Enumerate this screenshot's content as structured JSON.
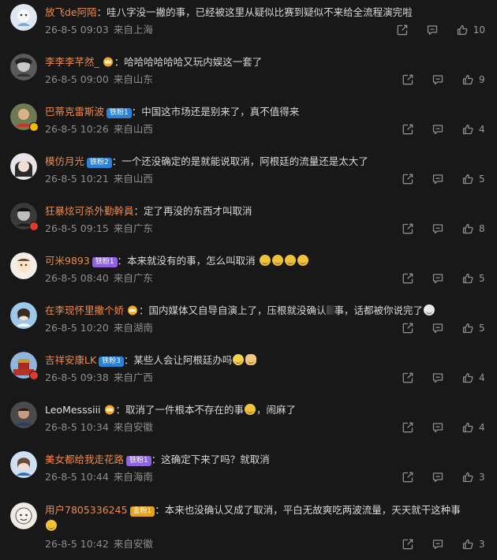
{
  "colors": {
    "background": "#181818",
    "username": "#ef8a45",
    "meta": "#8d8d8d",
    "text": "#d8d8d8"
  },
  "icons": {
    "share": "share-icon",
    "reply": "reply-icon",
    "like": "thumbs-up-icon"
  },
  "comments": [
    {
      "user": "放飞de阿陌",
      "badge": "",
      "text": "哇八字没一撇的事，已经被这里从疑似比赛到疑似不来给全流程演完啦",
      "time": "26-8-5 09:03",
      "loc": "来自上海",
      "likes": "10"
    },
    {
      "user": "李李李芊然_",
      "badge": "",
      "text": "哈哈哈哈哈哈又玩内娱这一套了",
      "time": "26-8-5 09:00",
      "loc": "来自山东",
      "likes": "9"
    },
    {
      "user": "巴蒂克雷斯波",
      "badge": "铁粉1",
      "text": "中国这市场还是别来了，真不值得来",
      "time": "26-8-5 10:26",
      "loc": "来自山西",
      "likes": "4"
    },
    {
      "user": "模仿月光",
      "badge": "铁粉2",
      "text": "一个还没确定的是就能说取消，阿根廷的流量还是太大了",
      "time": "26-8-5 10:21",
      "loc": "来自山西",
      "likes": "5"
    },
    {
      "user": "狂暴炫可杀外勤幹員",
      "badge": "",
      "text": "定了再没的东西才叫取消",
      "time": "26-8-5 09:15",
      "loc": "来自广东",
      "likes": "8"
    },
    {
      "user": "可米9893",
      "badge": "铁粉1",
      "text": "本来就没有的事，怎么叫取消",
      "time": "26-8-5 08:40",
      "loc": "来自广东",
      "likes": "5"
    },
    {
      "user": "在李现怀里撒个娇",
      "badge": "",
      "text_a": "国内媒体又自导自演上了，压根就没确认",
      "text_b": "事，话都被你说完了",
      "time": "26-8-5 10:20",
      "loc": "来自湖南",
      "likes": "5"
    },
    {
      "user": "吉祥安康LK",
      "badge": "铁粉3",
      "text": "某些人会让阿根廷办吗",
      "time": "26-8-5 09:38",
      "loc": "来自广西",
      "likes": "4"
    },
    {
      "user": "LeoMesssiii",
      "badge": "",
      "text_a": "取消了一件根本不存在的事",
      "text_b": "，闹麻了",
      "time": "26-8-5 10:34",
      "loc": "来自安徽",
      "likes": "4"
    },
    {
      "user": "美女都给我走花路",
      "badge": "铁粉1",
      "text": "这确定下来了吗？就取消",
      "time": "26-8-5 10:44",
      "loc": "来自海南",
      "likes": "3"
    },
    {
      "user": "用户7805336245",
      "badge": "金粉1",
      "text": "本来也没确认又成了取消，平白无故爽吃两波流量，天天就干这种事",
      "time": "26-8-5 10:42",
      "loc": "来自安徽",
      "likes": "3"
    }
  ]
}
